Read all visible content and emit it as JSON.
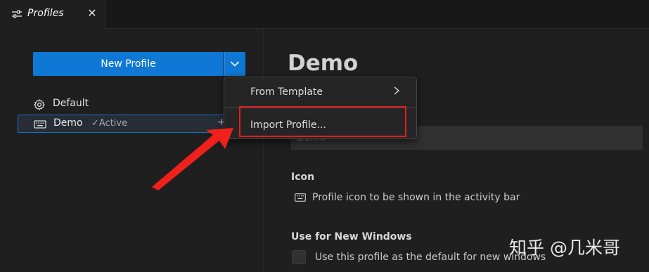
{
  "tab": {
    "title": "Profiles",
    "close_label": "✕"
  },
  "sidebar": {
    "new_profile_label": "New Profile",
    "profiles": [
      {
        "name": "Default",
        "icon": "gear-icon"
      },
      {
        "name": "Demo",
        "icon": "keyboard-icon",
        "status": "✓Active",
        "trailing": "+"
      }
    ]
  },
  "editor": {
    "heading": "Demo",
    "name_value": "Demo",
    "icon_label": "Icon",
    "icon_desc": "Profile icon to be shown in the activity bar",
    "windows_label": "Use for New Windows",
    "windows_desc": "Use this profile as the default for new windows",
    "windows_checked": false
  },
  "menu": {
    "items": [
      "From Template",
      "Import Profile..."
    ]
  },
  "colors": {
    "accent": "#0e78d4",
    "highlight": "#e41d1d",
    "arrow": "#f0211b"
  },
  "watermark": "知乎 @几米哥"
}
